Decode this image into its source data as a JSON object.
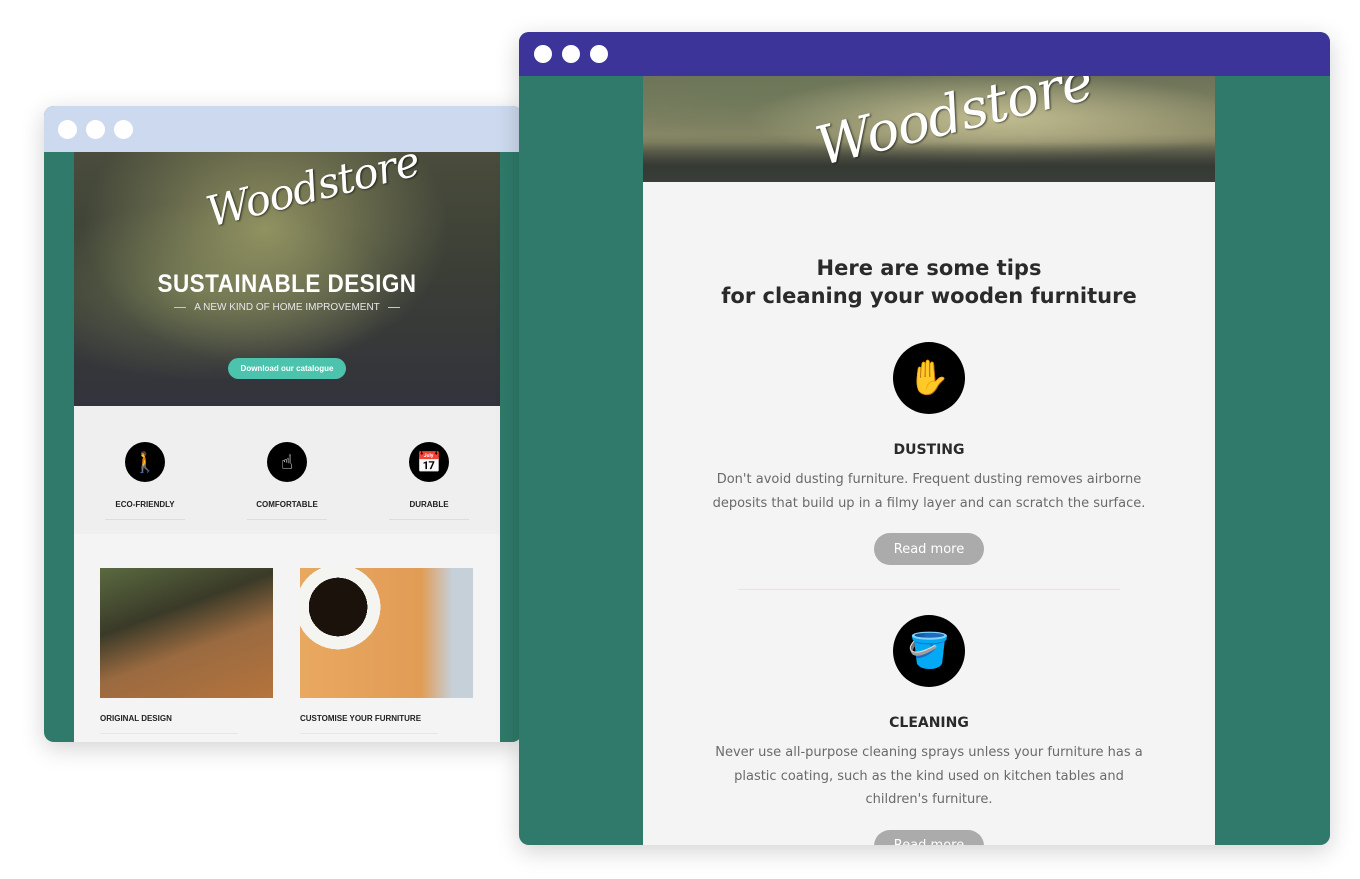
{
  "left_window": {
    "brand": "Woodstore",
    "hero": {
      "title": "SUSTAINABLE DESIGN",
      "subtitle": "A NEW KIND OF HOME IMPROVEMENT",
      "cta_label": "Download our catalogue",
      "cta_color": "#4cc3ad"
    },
    "features": [
      {
        "label": "ECO-FRIENDLY",
        "icon": "hiker-icon",
        "glyph": "🚶"
      },
      {
        "label": "COMFORTABLE",
        "icon": "pointing-hand-icon",
        "glyph": "☝"
      },
      {
        "label": "DURABLE",
        "icon": "calendar-clock-icon",
        "glyph": "📅"
      }
    ],
    "products": [
      {
        "label": "ORIGINAL DESIGN",
        "image": "outdoor-table-photo"
      },
      {
        "label": "CUSTOMISE YOUR FURNITURE",
        "image": "coffee-cup-on-wood-photo"
      }
    ],
    "titlebar_color": "#cdd9ee"
  },
  "right_window": {
    "brand": "Woodstore",
    "title_line1": "Here are some tips",
    "title_line2": "for cleaning your wooden furniture",
    "tips": [
      {
        "heading": "DUSTING",
        "icon": "dusting-hand-icon",
        "glyph": "✋",
        "text": "Don't avoid dusting furniture. Frequent dusting removes airborne deposits that build up in a filmy layer and can scratch the surface.",
        "button_label": "Read more"
      },
      {
        "heading": "CLEANING",
        "icon": "bucket-icon",
        "glyph": "🪣",
        "text": "Never use all-purpose cleaning sprays unless your furniture has a plastic coating, such as the kind used on kitchen tables and children's furniture.",
        "button_label": "Read more"
      }
    ],
    "titlebar_color": "#3c3498"
  },
  "colors": {
    "frame_green": "#2f7a6a",
    "page_bg": "#f4f4f4",
    "button_grey": "#ababab"
  }
}
